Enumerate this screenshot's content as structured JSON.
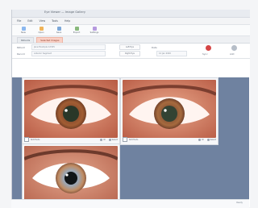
{
  "app": {
    "title": "Eye Viewer — Image Gallery",
    "menu": [
      "File",
      "Edit",
      "View",
      "Tools",
      "Help"
    ],
    "toolbar": [
      "New",
      "Open",
      "Save",
      "Export",
      "Settings"
    ]
  },
  "tabs": [
    {
      "label": "Patients"
    },
    {
      "label": "Selected Images",
      "active": true
    }
  ],
  "form": {
    "patient_label": "Patient",
    "patient_value": "Jane Example 12345",
    "record_label": "Record",
    "record_value": "Anterior Segment",
    "left_eye_label": "Left Eye",
    "right_eye_label": "Right Eye",
    "date_label": "Date",
    "date_value": "12 Jan 2020",
    "sync_label": "Sync",
    "add_label": "Add"
  },
  "cards": [
    {
      "name": "eye-card-1",
      "caption": "Slit Photo",
      "meta_a": "W",
      "meta_b": "Select"
    },
    {
      "name": "eye-card-2",
      "caption": "Slit Photo",
      "meta_a": "W",
      "meta_b": "Select"
    },
    {
      "name": "eye-card-3",
      "caption": "Slit Photo",
      "meta_a": "W",
      "meta_b": "Select"
    }
  ],
  "status": {
    "right_text": "Ready"
  },
  "colors": {
    "accent": "#d54545",
    "canvas": "#6f82a0",
    "tab_active": "#f9d1c6"
  }
}
